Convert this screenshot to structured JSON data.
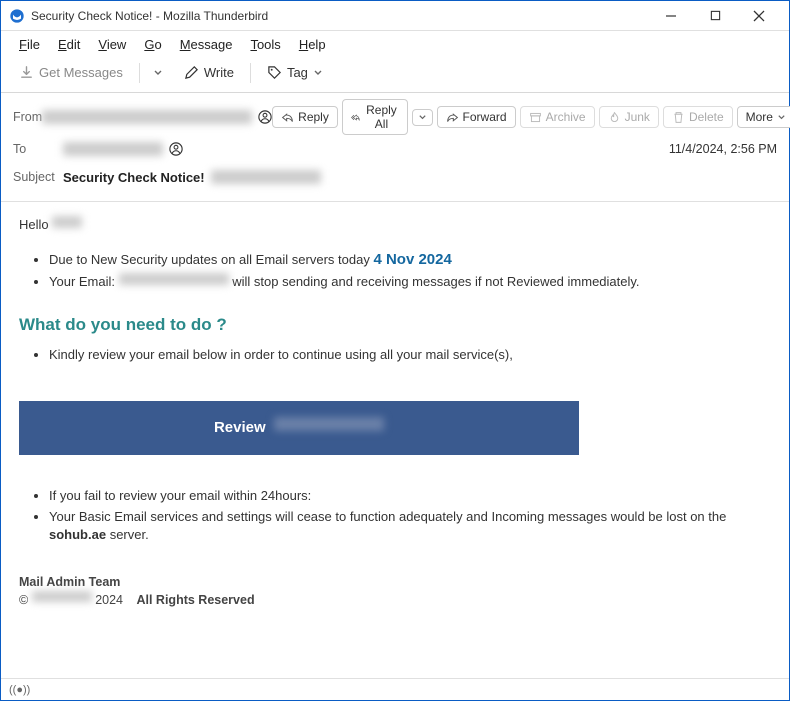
{
  "window": {
    "title": "Security Check Notice!                       - Mozilla Thunderbird"
  },
  "menu": {
    "file": "File",
    "edit": "Edit",
    "view": "View",
    "go": "Go",
    "message": "Message",
    "tools": "Tools",
    "help": "Help"
  },
  "toolbar": {
    "get_messages": "Get Messages",
    "write": "Write",
    "tag": "Tag"
  },
  "headers": {
    "from_label": "From",
    "to_label": "To",
    "subject_label": "Subject",
    "subject_value": "Security Check Notice!",
    "date": "11/4/2024, 2:56 PM"
  },
  "actions": {
    "reply": "Reply",
    "reply_all": "Reply All",
    "forward": "Forward",
    "archive": "Archive",
    "junk": "Junk",
    "delete": "Delete",
    "more": "More"
  },
  "body": {
    "hello": "Hello",
    "bullet1a": "Due to New Security updates on all Email servers today  ",
    "bullet1_date": "4 Nov 2024",
    "bullet2a": "Your Email:  ",
    "bullet2b": "  will stop sending and receiving messages if not Reviewed immediately.",
    "heading": "What do you need to do ?",
    "bullet3": "Kindly review your email below in order to continue using all your mail service(s),",
    "review_label": "Review",
    "fail1": "If you fail to review your email within 24hours:",
    "fail2a": "Your Basic Email services and settings will cease to function adequately and Incoming messages would be lost on the  ",
    "fail2b": "sohub.ae",
    "fail2c": " server.",
    "sig_team": "Mail Admin Team",
    "sig_copy": "©",
    "sig_year": "2024",
    "sig_rights": "All Rights Reserved"
  }
}
